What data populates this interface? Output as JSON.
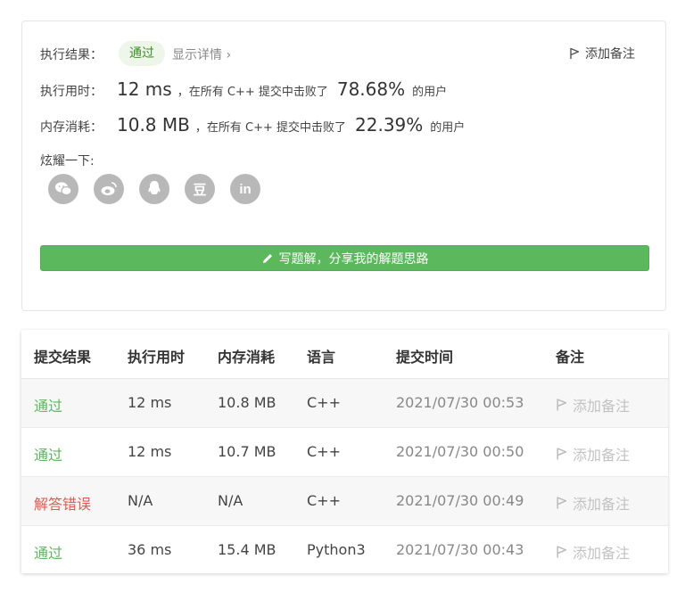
{
  "result": {
    "label": "执行结果：",
    "status": "通过",
    "detail_link": "显示详情 ›",
    "add_note": "添加备注"
  },
  "runtime": {
    "label": "执行用时：",
    "value": "12 ms",
    "middle": "，在所有 C++ 提交中击败了",
    "percent": "78.68%",
    "suffix": "的用户"
  },
  "memory": {
    "label": "内存消耗：",
    "value": "10.8 MB",
    "middle": "，在所有 C++ 提交中击败了",
    "percent": "22.39%",
    "suffix": "的用户"
  },
  "share": {
    "label": "炫耀一下:",
    "icons": [
      "wechat-icon",
      "weibo-icon",
      "qq-icon",
      "douban-icon",
      "linkedin-icon"
    ],
    "douban_glyph": "豆",
    "linkedin_glyph": "in"
  },
  "write_button": "写题解，分享我的解题思路",
  "table": {
    "headers": [
      "提交结果",
      "执行用时",
      "内存消耗",
      "语言",
      "提交时间",
      "备注"
    ],
    "rows": [
      {
        "status": "通过",
        "runtime": "12 ms",
        "memory": "10.8 MB",
        "language": "C++",
        "time": "2021/07/30 00:53",
        "note": "添加备注"
      },
      {
        "status": "通过",
        "runtime": "12 ms",
        "memory": "10.7 MB",
        "language": "C++",
        "time": "2021/07/30 00:50",
        "note": "添加备注"
      },
      {
        "status": "解答错误",
        "runtime": "N/A",
        "memory": "N/A",
        "language": "C++",
        "time": "2021/07/30 00:49",
        "note": "添加备注"
      },
      {
        "status": "通过",
        "runtime": "36 ms",
        "memory": "15.4 MB",
        "language": "Python3",
        "time": "2021/07/30 00:43",
        "note": "添加备注"
      }
    ]
  },
  "colors": {
    "accepted": "#5cb85c",
    "wrong_answer": "#e6584f",
    "button_green": "#5cb85c"
  }
}
